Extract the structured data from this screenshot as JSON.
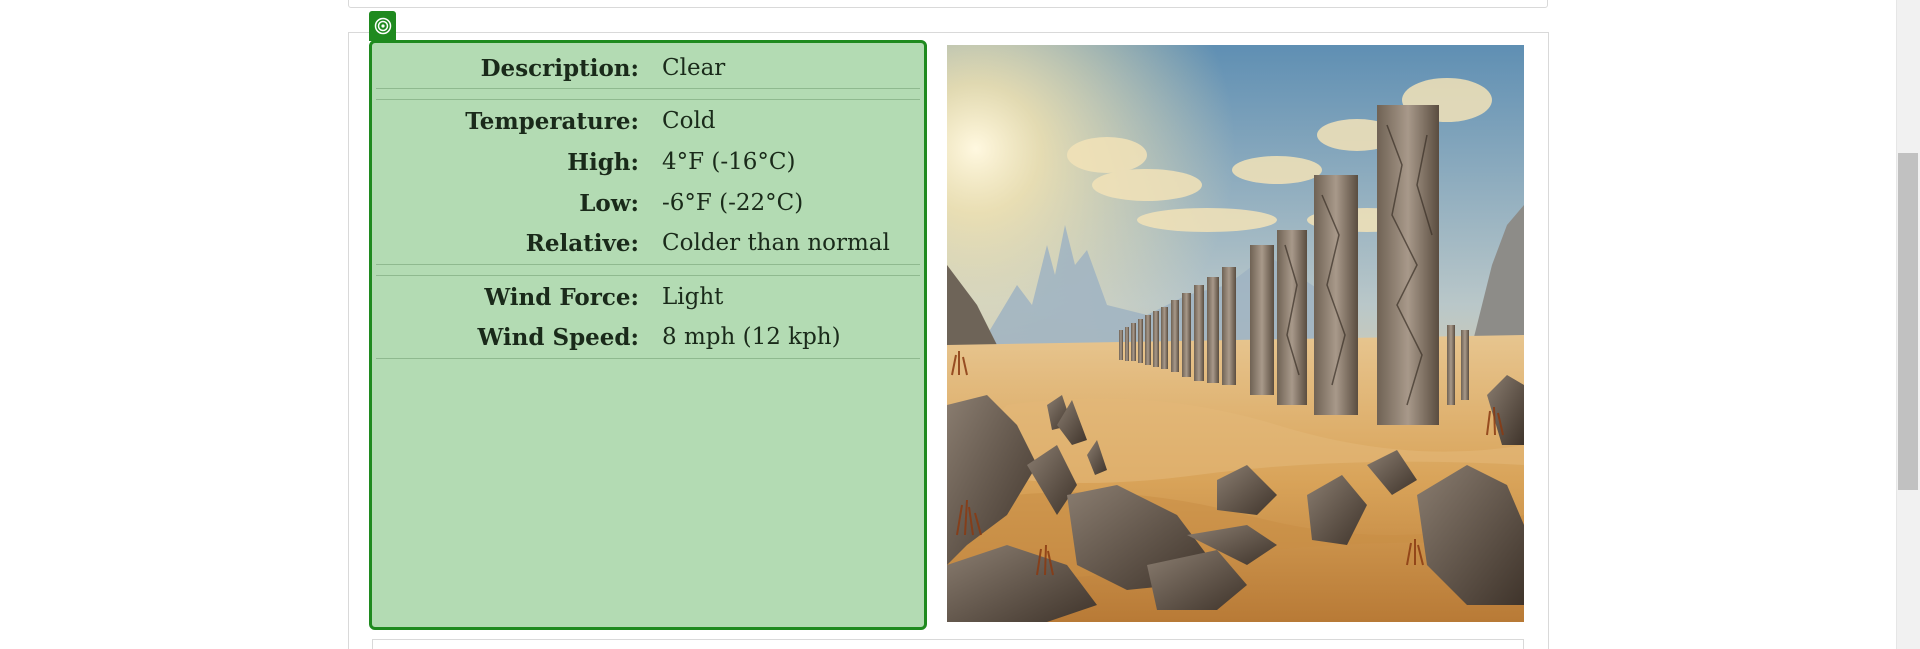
{
  "weather": {
    "rows": [
      {
        "label": "Description:",
        "value": "Clear"
      },
      {
        "label": "Temperature:",
        "value": "Cold"
      },
      {
        "label": "High:",
        "value": "4°F (-16°C)"
      },
      {
        "label": "Low:",
        "value": "-6°F (-22°C)"
      },
      {
        "label": "Relative:",
        "value": "Colder than normal"
      },
      {
        "label": "Wind Force:",
        "value": "Light"
      },
      {
        "label": "Wind Speed:",
        "value": "8 mph (12 kph)"
      }
    ]
  },
  "icons": {
    "panel_tag": "target-icon"
  },
  "colors": {
    "panel_background": "#b3dbb3",
    "panel_border": "#1f8a1f",
    "text": "#1a2a1a"
  }
}
